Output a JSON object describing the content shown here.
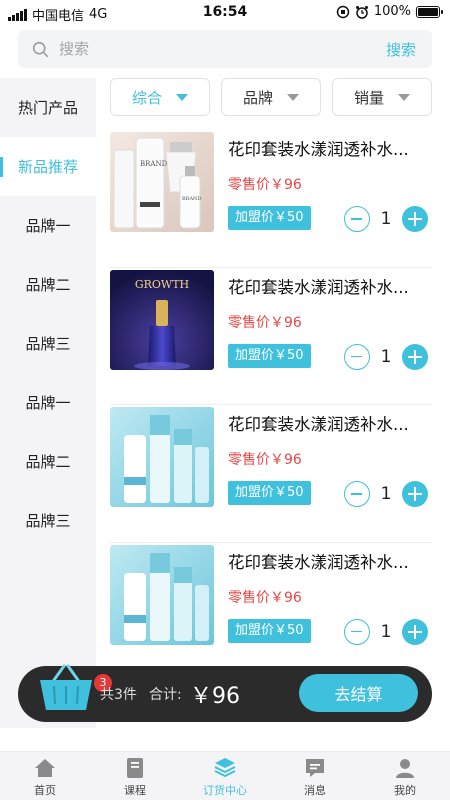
{
  "status_bar": {
    "carrier": "中国电信",
    "network": "4G",
    "time": "16:54",
    "battery": "100%"
  },
  "search": {
    "placeholder": "搜索",
    "button_label": "搜索"
  },
  "sidebar": {
    "items": [
      {
        "label": "热门产品"
      },
      {
        "label": "新品推荐"
      },
      {
        "label": "品牌一"
      },
      {
        "label": "品牌二"
      },
      {
        "label": "品牌三"
      },
      {
        "label": "品牌一"
      },
      {
        "label": "品牌二"
      },
      {
        "label": "品牌三"
      }
    ],
    "active_index": 1
  },
  "filters": [
    {
      "label": "综合",
      "active": true
    },
    {
      "label": "品牌",
      "active": false
    },
    {
      "label": "销量",
      "active": false
    }
  ],
  "products": [
    {
      "name": "花印套装水漾润透补水...",
      "retail": "零售价￥96",
      "wholesale": "加盟价￥50",
      "quantity": "1"
    },
    {
      "name": "花印套装水漾润透补水...",
      "retail": "零售价￥96",
      "wholesale": "加盟价￥50",
      "quantity": "1"
    },
    {
      "name": "花印套装水漾润透补水...",
      "retail": "零售价￥96",
      "wholesale": "加盟价￥50",
      "quantity": "1"
    },
    {
      "name": "花印套装水漾润透补水...",
      "retail": "零售价￥96",
      "wholesale": "加盟价￥50",
      "quantity": "1"
    }
  ],
  "thumb_text": {
    "brand": "BRAND",
    "growth": "GROWTH"
  },
  "cart": {
    "badge": "3",
    "count_label": "共3件",
    "total_label": "合计:",
    "total": "￥96",
    "checkout_label": "去结算"
  },
  "tabbar": [
    {
      "label": "首页",
      "icon": "home-icon"
    },
    {
      "label": "课程",
      "icon": "book-icon"
    },
    {
      "label": "订货中心",
      "icon": "layers-icon",
      "active": true
    },
    {
      "label": "消息",
      "icon": "message-icon"
    },
    {
      "label": "我的",
      "icon": "user-icon"
    }
  ],
  "colors": {
    "accent": "#3fc0dc",
    "price_red": "#e64646",
    "cart_bg": "#2b2b2b",
    "badge_red": "#e53935"
  }
}
